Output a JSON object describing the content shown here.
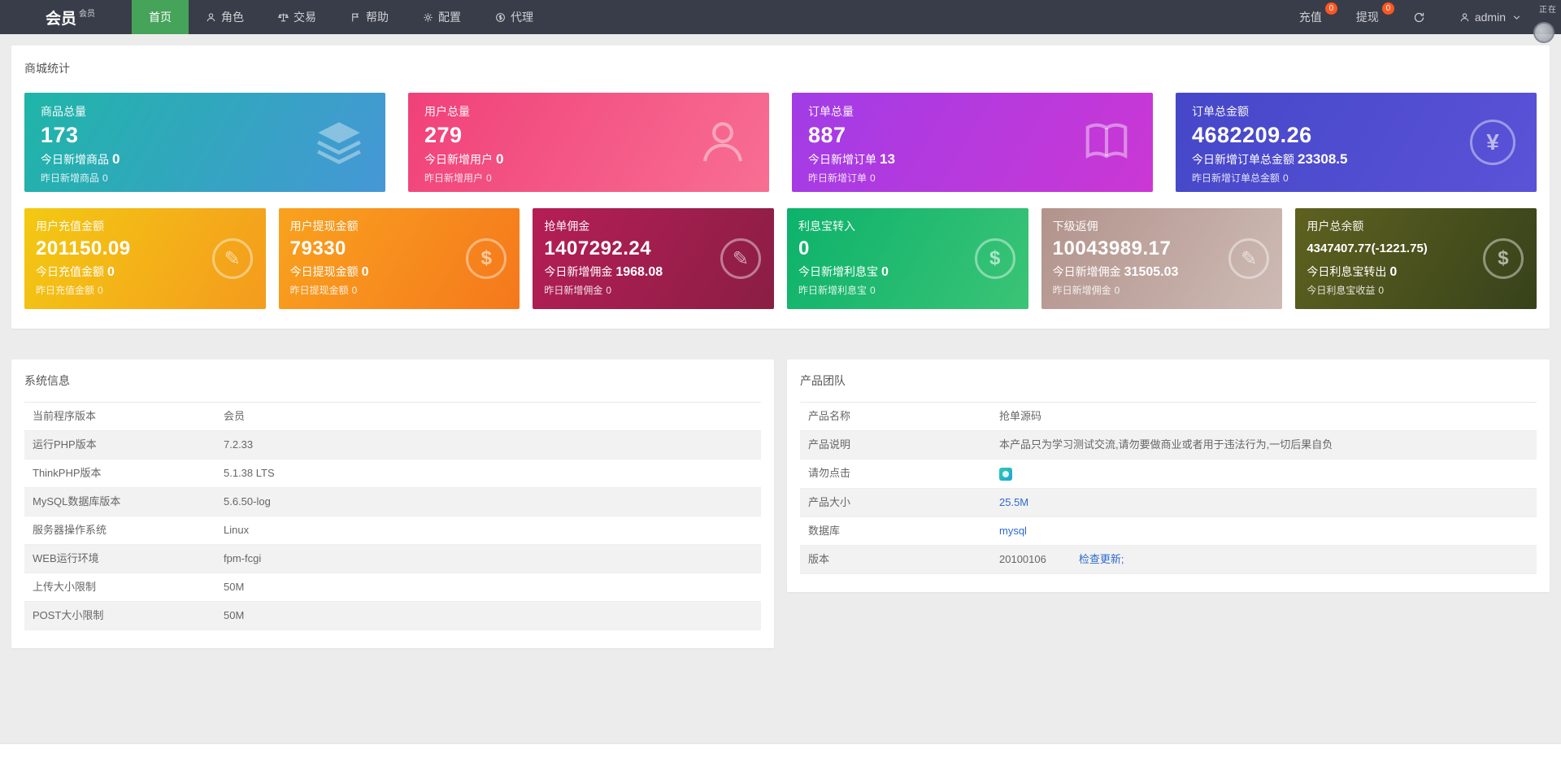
{
  "header": {
    "logo": "会员",
    "logo_sup": "会员",
    "bar_color": "#393D49",
    "active_color": "#46a35a",
    "badge_color": "#FF5722",
    "nav": [
      {
        "label": "首页"
      },
      {
        "label": "角色"
      },
      {
        "label": "交易"
      },
      {
        "label": "帮助"
      },
      {
        "label": "配置"
      },
      {
        "label": "代理"
      }
    ],
    "recharge_label": "充值",
    "recharge_badge": "0",
    "withdraw_label": "提现",
    "withdraw_badge": "0",
    "username": "admin"
  },
  "corner": {
    "text": "正在"
  },
  "stats": {
    "title": "商城统计",
    "row1": [
      {
        "title": "商品总量",
        "value": "173",
        "today_label": "今日新增商品",
        "today_value": "0",
        "yesterday_label": "昨日新增商品",
        "yesterday_value": "0",
        "icon": "layers-icon",
        "gradient": [
          "#1fb5a8",
          "#4697d6"
        ]
      },
      {
        "title": "用户总量",
        "value": "279",
        "today_label": "今日新增用户",
        "today_value": "0",
        "yesterday_label": "昨日新增用户",
        "yesterday_value": "0",
        "icon": "user-icon",
        "gradient": [
          "#f04179",
          "#f86e93"
        ]
      },
      {
        "title": "订单总量",
        "value": "887",
        "today_label": "今日新增订单",
        "today_value": "13",
        "yesterday_label": "昨日新增订单",
        "yesterday_value": "0",
        "icon": "book-icon",
        "gradient": [
          "#a13ce6",
          "#cb37d4"
        ]
      },
      {
        "title": "订单总金额",
        "value": "4682209.26",
        "today_label": "今日新增订单总金额",
        "today_value": "23308.5",
        "yesterday_label": "昨日新增订单总金额",
        "yesterday_value": "0",
        "icon": "yen-icon",
        "gradient": [
          "#4547c8",
          "#5b52d8"
        ]
      }
    ],
    "row2": [
      {
        "title": "用户充值金额",
        "value": "201150.09",
        "today_label": "今日充值金额",
        "today_value": "0",
        "yesterday_label": "昨日充值金额",
        "yesterday_value": "0",
        "icon": "pen-icon",
        "gradient": [
          "#f3c912",
          "#f49b1e"
        ]
      },
      {
        "title": "用户提现金额",
        "value": "79330",
        "today_label": "今日提现金额",
        "today_value": "0",
        "yesterday_label": "昨日提现金额",
        "yesterday_value": "0",
        "icon": "dollar-icon",
        "gradient": [
          "#f9a21f",
          "#f5781c"
        ]
      },
      {
        "title": "抢单佣金",
        "value": "1407292.24",
        "today_label": "今日新增佣金",
        "today_value": "1968.08",
        "yesterday_label": "昨日新增佣金",
        "yesterday_value": "0",
        "icon": "pen-icon",
        "gradient": [
          "#b51e55",
          "#8a1e44"
        ]
      },
      {
        "title": "利息宝转入",
        "value": "0",
        "today_label": "今日新增利息宝",
        "today_value": "0",
        "yesterday_label": "昨日新增利息宝",
        "yesterday_value": "0",
        "icon": "dollar-icon",
        "gradient": [
          "#0cb26b",
          "#3bc476"
        ]
      },
      {
        "title": "下级返佣",
        "value": "10043989.17",
        "today_label": "今日新增佣金",
        "today_value": "31505.03",
        "yesterday_label": "昨日新增佣金",
        "yesterday_value": "0",
        "icon": "pen-icon",
        "gradient": [
          "#b2938c",
          "#cebbb5"
        ]
      },
      {
        "title": "用户总余额",
        "value": "4347407.77(-1221.75)",
        "today_label": "今日利息宝转出",
        "today_value": "0",
        "yesterday_label": "今日利息宝收益",
        "yesterday_value": "0",
        "icon": "dollar-icon",
        "gradient": [
          "#5e611f",
          "#37421b"
        ]
      }
    ]
  },
  "system_info": {
    "title": "系统信息",
    "rows": [
      {
        "label": "当前程序版本",
        "value": "会员"
      },
      {
        "label": "运行PHP版本",
        "value": "7.2.33"
      },
      {
        "label": "ThinkPHP版本",
        "value": "5.1.38 LTS"
      },
      {
        "label": "MySQL数据库版本",
        "value": "5.6.50-log"
      },
      {
        "label": "服务器操作系统",
        "value": "Linux"
      },
      {
        "label": "WEB运行环境",
        "value": "fpm-fcgi"
      },
      {
        "label": "上传大小限制",
        "value": "50M"
      },
      {
        "label": "POST大小限制",
        "value": "50M"
      }
    ]
  },
  "product_team": {
    "title": "产品团队",
    "rows": {
      "name": {
        "label": "产品名称",
        "value": "抢单源码"
      },
      "desc": {
        "label": "产品说明",
        "value": "本产品只为学习测试交流,请勿要做商业或者用于违法行为,一切后果自负"
      },
      "no_click": {
        "label": "请勿点击"
      },
      "size": {
        "label": "产品大小",
        "value": "25.5M"
      },
      "db": {
        "label": "数据库",
        "value": "mysql"
      },
      "version": {
        "label": "版本",
        "value": "20100106",
        "link": "检查更新;"
      }
    }
  },
  "colors": {
    "link": "#2d6ccd"
  }
}
